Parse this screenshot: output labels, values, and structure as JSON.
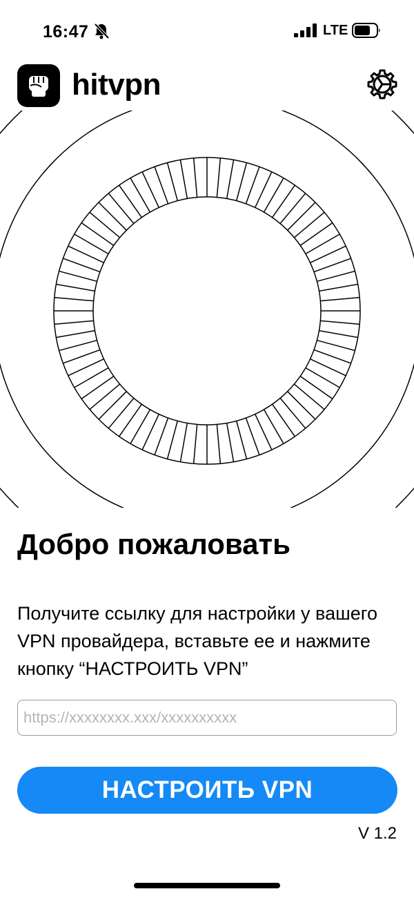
{
  "status_bar": {
    "time": "16:47",
    "network": "LTE",
    "icons": [
      "bell-slash-icon",
      "cellular-signal-icon",
      "battery-icon"
    ]
  },
  "header": {
    "app_name": "hitvpn",
    "logo_icon": "raised-fist-icon",
    "settings_icon": "gear-icon"
  },
  "main": {
    "welcome_title": "Добро пожаловать",
    "instructions": "Получите ссылку для настройки у вашего VPN провайдера, вставьте ее и нажмите кнопку “НАСТРОИТЬ VPN”",
    "url_field": {
      "placeholder": "https://xxxxxxxx.xxx/xxxxxxxxxx",
      "value": ""
    },
    "setup_button_label": "НАСТРОИТЬ VPN",
    "version": "V 1.2"
  },
  "colors": {
    "accent": "#1589f5",
    "background": "#ffffff",
    "text": "#000000"
  }
}
